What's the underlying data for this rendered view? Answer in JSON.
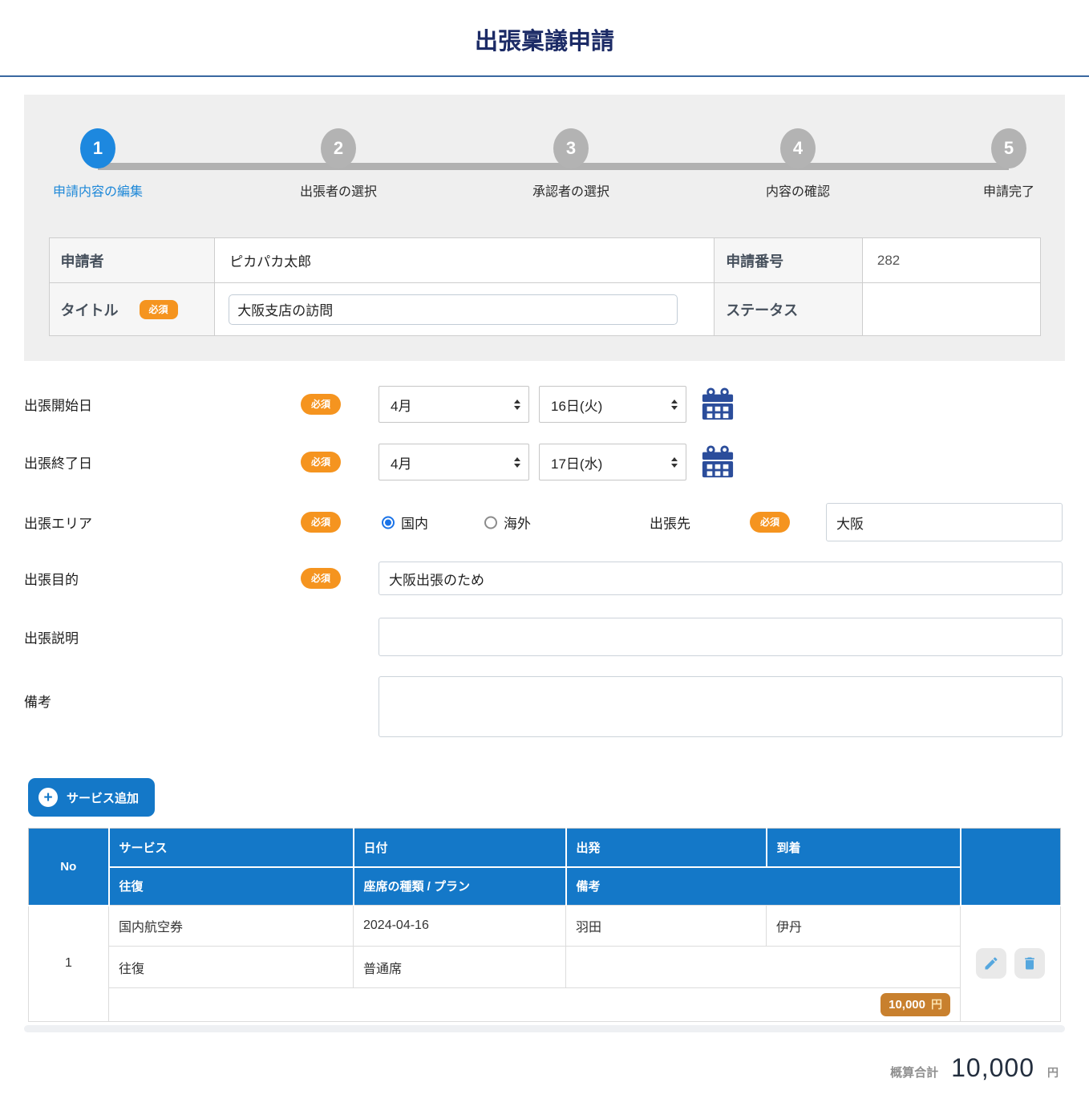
{
  "colors": {
    "primary_blue": "#1478c8",
    "step_active_blue": "#1d88df",
    "required_badge_orange": "#f5941f",
    "price_badge_orange": "#c8802e",
    "title_navy": "#1c2b66"
  },
  "page": {
    "title": "出張稟議申請"
  },
  "stepper": {
    "steps": [
      {
        "number": "1",
        "label": "申請内容の編集"
      },
      {
        "number": "2",
        "label": "出張者の選択"
      },
      {
        "number": "3",
        "label": "承認者の選択"
      },
      {
        "number": "4",
        "label": "内容の確認"
      },
      {
        "number": "5",
        "label": "申請完了"
      }
    ]
  },
  "badges": {
    "required": "必須"
  },
  "applicant": {
    "applicant_label": "申請者",
    "applicant_value": "ピカパカ太郎",
    "number_label": "申請番号",
    "number_value": "282",
    "title_label": "タイトル",
    "title_value": "大阪支店の訪問",
    "status_label": "ステータス",
    "status_value": ""
  },
  "form": {
    "start_date": {
      "label": "出張開始日",
      "month": "4月",
      "day": "16日(火)"
    },
    "end_date": {
      "label": "出張終了日",
      "month": "4月",
      "day": "17日(水)"
    },
    "area": {
      "label": "出張エリア",
      "domestic": "国内",
      "overseas": "海外",
      "destination_label": "出張先",
      "destination_value": "大阪"
    },
    "purpose": {
      "label": "出張目的",
      "value": "大阪出張のため"
    },
    "description": {
      "label": "出張説明",
      "value": ""
    },
    "remarks": {
      "label": "備考",
      "value": ""
    }
  },
  "service": {
    "add_button_label": "サービス追加",
    "table": {
      "headers": {
        "no": "No",
        "service": "サービス",
        "date": "日付",
        "departure": "出発",
        "arrival": "到着",
        "round_trip": "往復",
        "seat_plan": "座席の種類 / プラン",
        "note": "備考"
      },
      "rows": [
        {
          "no": "1",
          "service": "国内航空券",
          "date": "2024-04-16",
          "departure": "羽田",
          "arrival": "伊丹",
          "round_trip": "往復",
          "seat_plan": "普通席",
          "note": "",
          "price": "10,000",
          "currency": "円"
        }
      ]
    }
  },
  "total": {
    "label": "概算合計",
    "value": "10,000",
    "currency": "円"
  }
}
